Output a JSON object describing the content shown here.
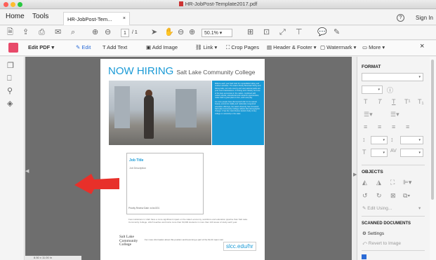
{
  "window": {
    "title": "HR-JobPost-Template2017.pdf"
  },
  "menu": {
    "home": "Home",
    "tools": "Tools",
    "tab_label": "HR-JobPost-Tem...",
    "tab_close": "×",
    "help": "?",
    "signin": "Sign In"
  },
  "toolbar": {
    "page_current": "1",
    "page_total": "/ 1",
    "zoom": "50.1%"
  },
  "editbar": {
    "title": "Edit PDF",
    "edit": "Edit",
    "add_text": "Add Text",
    "add_image": "Add Image",
    "link": "Link",
    "crop": "Crop Pages",
    "header_footer": "Header & Footer",
    "watermark": "Watermark",
    "more": "More",
    "close": "×"
  },
  "page": {
    "headline": "NOW HIRING",
    "subhead": "Salt Lake Community College",
    "blurb1": "Millions each year Salt Utah for unparalleled skiing and outdoor activities. The state's Rocky Mountain hiking and biking trails, red rock country and vast national parks are year-round destinations. A thriving tech industry and one of the best economies in the nation, combined with varied cultural, educational and research opportunities, make Utah a great place to live, work and play.",
    "blurb2": "As more people have discovered Utah for its natural beauty, economic vitality and nationally recognized education offerings, the state's diversity has increased. Salt Lake Community College reflects that demographic change: it has the most diverse student body of any college or university in the state.",
    "job_title": "Job Title",
    "job_desc": "Job Description",
    "priority": "Priority Review Date: xx/xx/201",
    "footer": "Few institutions in Utah have a more significant impact on the state's economy, workforce and education pipeline than Salt Lake Community College, which teaches and trains more than 60,000 students in more than 120 areas of study each year.",
    "logo1": "Salt Lake",
    "logo2": "Community",
    "logo3": "College",
    "more_info": "For more information about this position and becoming a part of the SLCC team visit",
    "url": "slcc.edu/hr"
  },
  "rightpanel": {
    "format": "FORMAT",
    "objects": "OBJECTS",
    "edit_using": "Edit Using...",
    "scanned": "SCANNED DOCUMENTS",
    "settings": "Settings",
    "revert": "Revert to Image"
  },
  "status": {
    "size": "8.50 x 11.00 in"
  }
}
